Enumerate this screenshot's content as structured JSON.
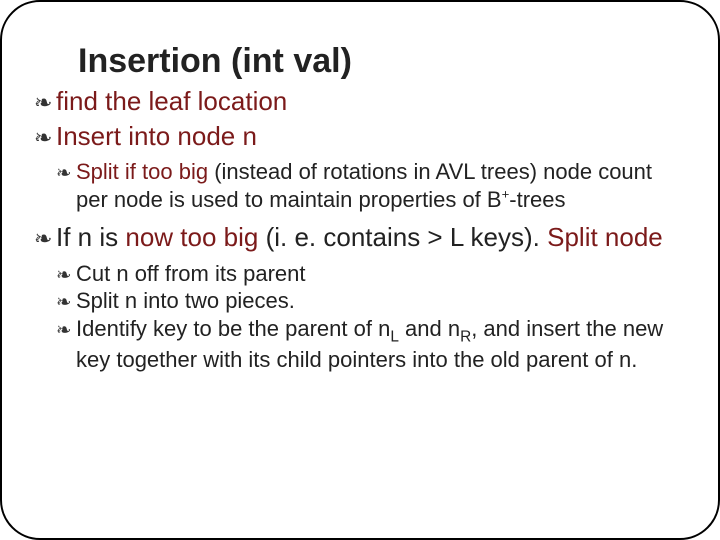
{
  "title": "Insertion  (int val)",
  "items": [
    {
      "parts": [
        {
          "t": "find the leaf location",
          "red": true
        }
      ]
    },
    {
      "parts": [
        {
          "t": "Insert into node n",
          "red": true
        }
      ],
      "children": [
        {
          "parts": [
            {
              "t": "Split if too big",
              "red": true
            },
            {
              "t": " (instead of rotations in AVL trees) node count per node is used to maintain properties of B"
            },
            {
              "t": "+",
              "sup": true
            },
            {
              "t": "-trees"
            }
          ]
        }
      ]
    },
    {
      "parts": [
        {
          "t": "If n is "
        },
        {
          "t": "now too big",
          "red": true
        },
        {
          "t": " (i. e. contains > L keys). "
        },
        {
          "t": "Split node",
          "red": true
        }
      ],
      "children": [
        {
          "parts": [
            {
              "t": "Cut n off from its parent"
            }
          ]
        },
        {
          "parts": [
            {
              "t": "Split n into two pieces."
            }
          ]
        },
        {
          "parts": [
            {
              "t": "Identify key to be the parent of n"
            },
            {
              "t": "L",
              "sub": true
            },
            {
              "t": " and n"
            },
            {
              "t": "R",
              "sub": true
            },
            {
              "t": ", and insert the new key together with its child pointers into the old parent of n."
            }
          ]
        }
      ]
    }
  ],
  "bullet_glyph": "❧"
}
